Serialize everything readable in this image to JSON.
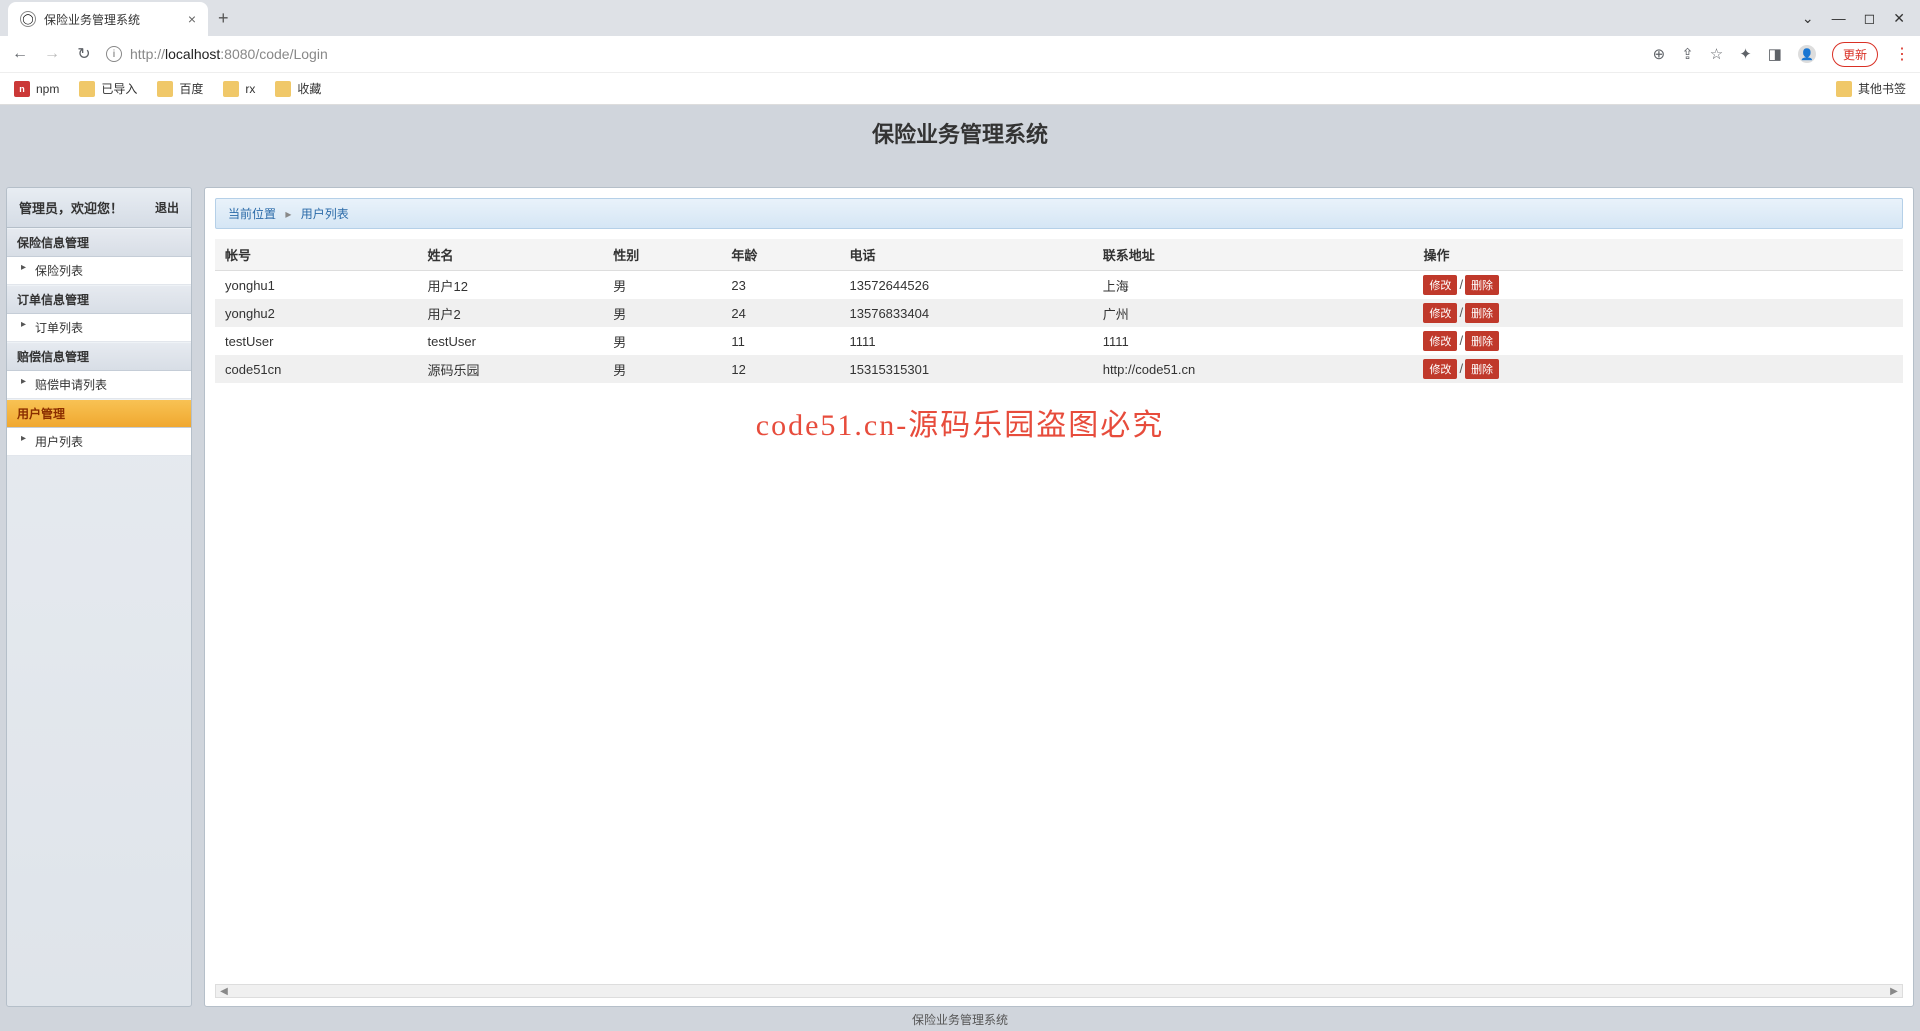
{
  "browser": {
    "tab_title": "保险业务管理系统",
    "url_prefix": "http://",
    "url_host": "localhost",
    "url_port": ":8080",
    "url_path": "/code/Login",
    "update_label": "更新",
    "bookmarks": [
      {
        "label": "npm"
      },
      {
        "label": "已导入"
      },
      {
        "label": "百度"
      },
      {
        "label": "rx"
      },
      {
        "label": "收藏"
      }
    ],
    "other_bookmarks": "其他书签"
  },
  "app": {
    "title": "保险业务管理系统"
  },
  "sidebar": {
    "welcome": "管理员，欢迎您！",
    "logout": "退出",
    "groups": [
      {
        "label": "保险信息管理",
        "items": [
          {
            "label": "保险列表"
          }
        ],
        "active": false
      },
      {
        "label": "订单信息管理",
        "items": [
          {
            "label": "订单列表"
          }
        ],
        "active": false
      },
      {
        "label": "赔偿信息管理",
        "items": [
          {
            "label": "赔偿申请列表"
          }
        ],
        "active": false
      },
      {
        "label": "用户管理",
        "items": [
          {
            "label": "用户列表"
          }
        ],
        "active": true
      }
    ]
  },
  "breadcrumb": {
    "prefix": "当前位置",
    "current": "用户列表"
  },
  "table": {
    "headers": [
      "帐号",
      "姓名",
      "性别",
      "年龄",
      "电话",
      "联系地址",
      "操作"
    ],
    "edit_label": "修改",
    "delete_label": "删除",
    "rows": [
      {
        "account": "yonghu1",
        "name": "用户12",
        "gender": "男",
        "age": "23",
        "phone": "13572644526",
        "address": "上海"
      },
      {
        "account": "yonghu2",
        "name": "用户2",
        "gender": "男",
        "age": "24",
        "phone": "13576833404",
        "address": "广州"
      },
      {
        "account": "testUser",
        "name": "testUser",
        "gender": "男",
        "age": "11",
        "phone": "1111",
        "address": "1111"
      },
      {
        "account": "code51cn",
        "name": "源码乐园",
        "gender": "男",
        "age": "12",
        "phone": "15315315301",
        "address": "http://code51.cn"
      }
    ]
  },
  "watermark": "code51.cn-源码乐园盗图必究",
  "footer": "保险业务管理系统"
}
